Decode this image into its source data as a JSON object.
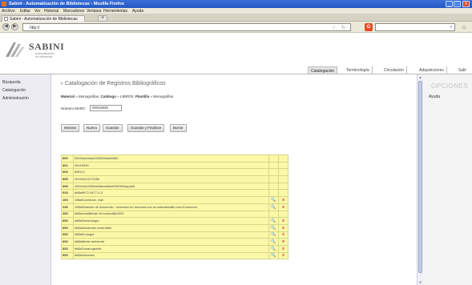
{
  "window": {
    "title": "Sabini - Automatización de Bibliotecas - Mozilla Firefox",
    "minimize": "_",
    "maximize": "□",
    "close": "x"
  },
  "menu": [
    "Archivo",
    "Editar",
    "Ver",
    "Historial",
    "Marcadores",
    "Ventana",
    "Herramientas",
    "Ayuda"
  ],
  "browser": {
    "tab_title": "Sabini - Automatización de Bibliotecas",
    "new_tab": "+",
    "url": "http://",
    "back_glyph": "◀",
    "forward_glyph": "▶",
    "star_glyph": "☆",
    "reload_glyph": "↻",
    "search_glyph": "⌕",
    "google_glyph": "G",
    "home_glyph": "⌂"
  },
  "header": {
    "logo_text": "SABINI",
    "logo_sub_1": "automatización",
    "logo_sub_2": "de bibliotecas",
    "nav_tabs": [
      "Catalogación",
      "Terminología",
      "Circulación",
      "Adquisiciones",
      "Salir"
    ]
  },
  "sidebar": {
    "items": [
      "Búsqueda",
      "Catalogación",
      "Administración"
    ]
  },
  "main": {
    "title_arrow": "»",
    "title": "Catalogación de Registros Bibliográficos",
    "breadcrumb": {
      "material_label": "Material",
      "material_value": "Monografías",
      "catalogo_label": "Catálogo",
      "catalogo_value": "LIBROS",
      "plantilla_label": "Plantilla",
      "plantilla_value": "Monografías"
    },
    "marc_label": "Número MARC",
    "marc_value": "00015930",
    "buttons": [
      "Mostrar",
      "Nuevo",
      "Guardar",
      "Guardar y Finalizar",
      "Borrar"
    ]
  },
  "marc_records": [
    {
      "tag": "000",
      "value": "00000nam#a2200000#a#4500",
      "search": false,
      "delete": false
    },
    {
      "tag": "001",
      "value": "00015930",
      "search": false,
      "delete": false
    },
    {
      "tag": "003",
      "value": "INECO",
      "search": false,
      "delete": false
    },
    {
      "tag": "005",
      "value": "20100414172356",
      "search": false,
      "delete": false
    },
    {
      "tag": "008",
      "value": "100414s2002####bo#####0000#0#spa#d",
      "search": false,
      "delete": false
    },
    {
      "tag": "020",
      "value": "##$a9972-0477-0-3",
      "search": false,
      "delete": false
    },
    {
      "tag": "100",
      "value": "1#$aKurcinova, Iván",
      "search": true,
      "delete": true
    },
    {
      "tag": "245",
      "value": "10$aRelación de desarrollo : inversión en armonía con la naturaleza$c Iván Kurcinova",
      "search": true,
      "delete": true
    },
    {
      "tag": "260",
      "value": "##$aLima$bIván Kurcinova$c2002",
      "search": false,
      "delete": false
    },
    {
      "tag": "653",
      "value": "##$aDendrología",
      "search": true,
      "delete": true
    },
    {
      "tag": "653",
      "value": "##$aDesarrollo sostenible",
      "search": true,
      "delete": true
    },
    {
      "tag": "653",
      "value": "##$aEcología",
      "search": true,
      "delete": true
    },
    {
      "tag": "653",
      "value": "##$aMedio ambiente",
      "search": true,
      "delete": true
    },
    {
      "tag": "653",
      "value": "##$aOceanografía",
      "search": true,
      "delete": true
    },
    {
      "tag": "653",
      "value": "##$aVolcanes",
      "search": true,
      "delete": true
    }
  ],
  "table_glyphs": {
    "search": "🔍",
    "delete": "x"
  },
  "scrollbar": {
    "up": "▲",
    "down": "▼"
  },
  "options": {
    "title": "OPCIONES",
    "help": "Ayuda"
  }
}
